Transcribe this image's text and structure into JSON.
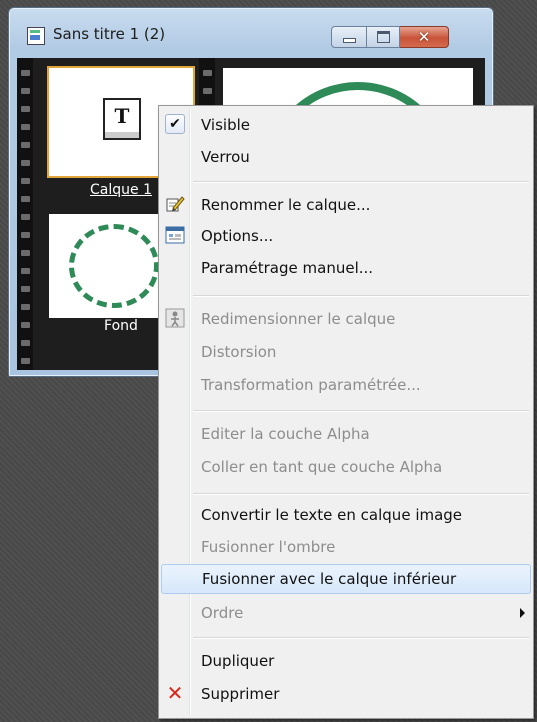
{
  "window": {
    "title": "Sans titre 1 (2)",
    "controls": {
      "minimize": "minimize",
      "maximize": "maximize",
      "close": "✕"
    }
  },
  "layers": [
    {
      "label": "Calque 1",
      "type": "text",
      "icon_glyph": "T",
      "selected": true
    },
    {
      "label": "Fond",
      "type": "image",
      "selected": false
    }
  ],
  "menu": {
    "items": [
      {
        "label": "Visible",
        "enabled": true,
        "checked": true
      },
      {
        "label": "Verrou",
        "enabled": true
      },
      {
        "label": "Renommer le calque...",
        "enabled": true,
        "icon": "rename-pencil-icon"
      },
      {
        "label": "Options...",
        "enabled": true,
        "icon": "options-dialog-icon"
      },
      {
        "label": "Paramétrage manuel...",
        "enabled": true
      },
      {
        "label": "Redimensionner le calque",
        "enabled": false,
        "icon": "resize-layer-icon"
      },
      {
        "label": "Distorsion",
        "enabled": false
      },
      {
        "label": "Transformation paramétrée...",
        "enabled": false
      },
      {
        "label": "Editer la couche Alpha",
        "enabled": false
      },
      {
        "label": "Coller en tant que couche Alpha",
        "enabled": false
      },
      {
        "label": "Convertir le texte en calque image",
        "enabled": true
      },
      {
        "label": "Fusionner l'ombre",
        "enabled": false
      },
      {
        "label": "Fusionner avec le calque inférieur",
        "enabled": true,
        "highlighted": true
      },
      {
        "label": "Ordre",
        "enabled": false,
        "submenu": true
      },
      {
        "label": "Dupliquer",
        "enabled": true
      },
      {
        "label": "Supprimer",
        "enabled": true,
        "icon": "delete-x-icon"
      }
    ]
  },
  "colors": {
    "accent_ring": "#2e8b57",
    "selection_border": "#e1a53a",
    "menu_highlight": "#d7e8fa",
    "delete_red": "#d9261c"
  }
}
